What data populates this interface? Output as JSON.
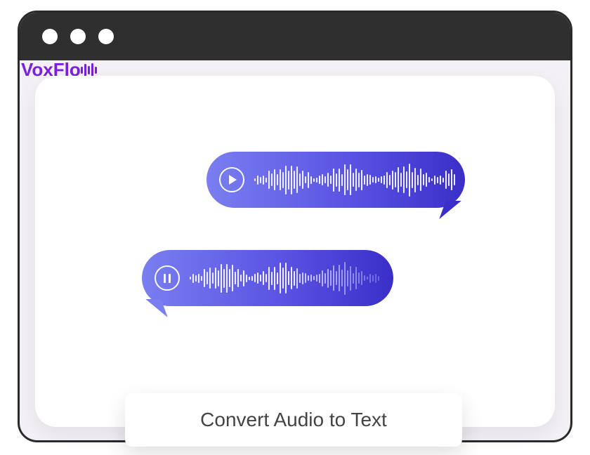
{
  "logo": {
    "text": "VoxFlo"
  },
  "bubbles": {
    "first": {
      "control_icon": "play-icon"
    },
    "second": {
      "control_icon": "pause-icon"
    }
  },
  "cta": {
    "label": "Convert Audio to Text"
  }
}
